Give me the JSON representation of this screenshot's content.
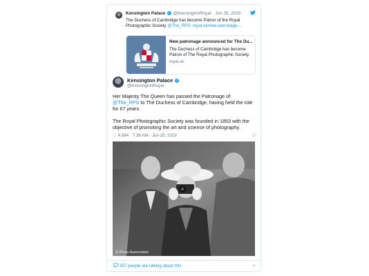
{
  "quoted": {
    "name": "Kensington Palace",
    "handle": "@KensingtonRoyal",
    "date": "· Jun 25, 2019",
    "text": "The Duchess of Cambridge has become Patron of the Royal Photographic Society ",
    "mention": "@The_RPS",
    "url": ": royal.uk/new-patronage-...",
    "link_card": {
      "title": "New patronage announced for The Du...",
      "description": "The Duchess of Cambridge has become Patron of The Royal Photographic Society.",
      "domain": "royal.uk"
    }
  },
  "main": {
    "name": "Kensington Palace",
    "handle": "@KensingtonRoyal",
    "p1_before": "Her Majesty The Queen has passed the Patronage of ",
    "p1_mention": "@The_RPS",
    "p1_after": " to The Duchess of Cambridge, having held the role for 67 years.",
    "p2": "The Royal Photographic Society was founded in 1853 with the objective of promoting the art and science of photography.",
    "likes": "4,094",
    "timestamp": "7:38 AM - Jun 25, 2019",
    "photo_credit": "© Press Association"
  },
  "footer": {
    "talking": "357 people are talking about this"
  },
  "icons": {
    "verified": "verified-badge-icon",
    "twitter": "twitter-bird-icon",
    "heart": "heart-icon",
    "info": "info-icon",
    "comment": "comment-bubble-icon",
    "chevron": "chevron-right-icon"
  },
  "colors": {
    "accent": "#1da1f2",
    "link": "#1b95e0",
    "muted": "#657786"
  }
}
